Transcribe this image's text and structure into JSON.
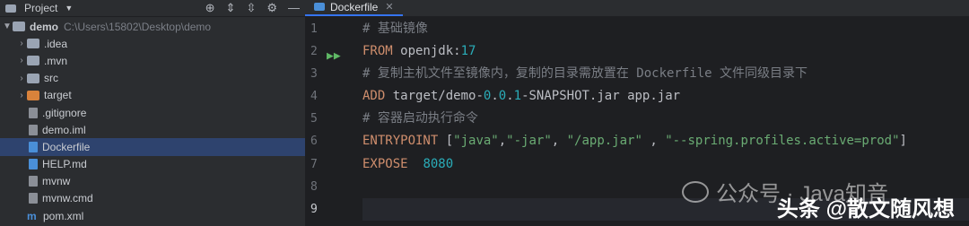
{
  "project": {
    "title": "Project",
    "root_name": "demo",
    "root_path": "C:\\Users\\15802\\Desktop\\demo",
    "items": [
      {
        "label": ".idea",
        "type": "folder",
        "expandable": true
      },
      {
        "label": ".mvn",
        "type": "folder",
        "expandable": true
      },
      {
        "label": "src",
        "type": "folder",
        "expandable": true
      },
      {
        "label": "target",
        "type": "folder-orange",
        "expandable": true
      },
      {
        "label": ".gitignore",
        "type": "file"
      },
      {
        "label": "demo.iml",
        "type": "file"
      },
      {
        "label": "Dockerfile",
        "type": "file-doc",
        "selected": true
      },
      {
        "label": "HELP.md",
        "type": "file-doc"
      },
      {
        "label": "mvnw",
        "type": "file"
      },
      {
        "label": "mvnw.cmd",
        "type": "file"
      },
      {
        "label": "pom.xml",
        "type": "maven"
      }
    ]
  },
  "editor": {
    "tab_label": "Dockerfile",
    "lines": [
      "1",
      "2",
      "3",
      "4",
      "5",
      "6",
      "7",
      "8",
      "9"
    ],
    "code": {
      "l1": "# 基础镜像",
      "l2_kw": "FROM",
      "l2_a": " openjdk:",
      "l2_num": "17",
      "l3": "# 复制主机文件至镜像内，复制的目录需放置在 Dockerfile 文件同级目录下",
      "l4_kw": "ADD",
      "l4_a": " target/demo-",
      "l4_num1": "0",
      "l4_b": ".",
      "l4_num2": "0",
      "l4_c": ".",
      "l4_num3": "1",
      "l4_d": "-SNAPSHOT.jar app.jar",
      "l5": "# 容器启动执行命令",
      "l6_kw": "ENTRYPOINT",
      "l6_a": " [",
      "l6_s1": "\"java\"",
      "l6_b": ",",
      "l6_s2": "\"-jar\"",
      "l6_c": ", ",
      "l6_s3": "\"/app.jar\"",
      "l6_d": " , ",
      "l6_s4": "\"--spring.profiles.active=prod\"",
      "l6_e": "]",
      "l7_kw": "EXPOSE",
      "l7_num": "8080"
    }
  },
  "watermarks": {
    "wechat": "公众号 · Java知音",
    "toutiao": "头条 @散文随风想"
  }
}
